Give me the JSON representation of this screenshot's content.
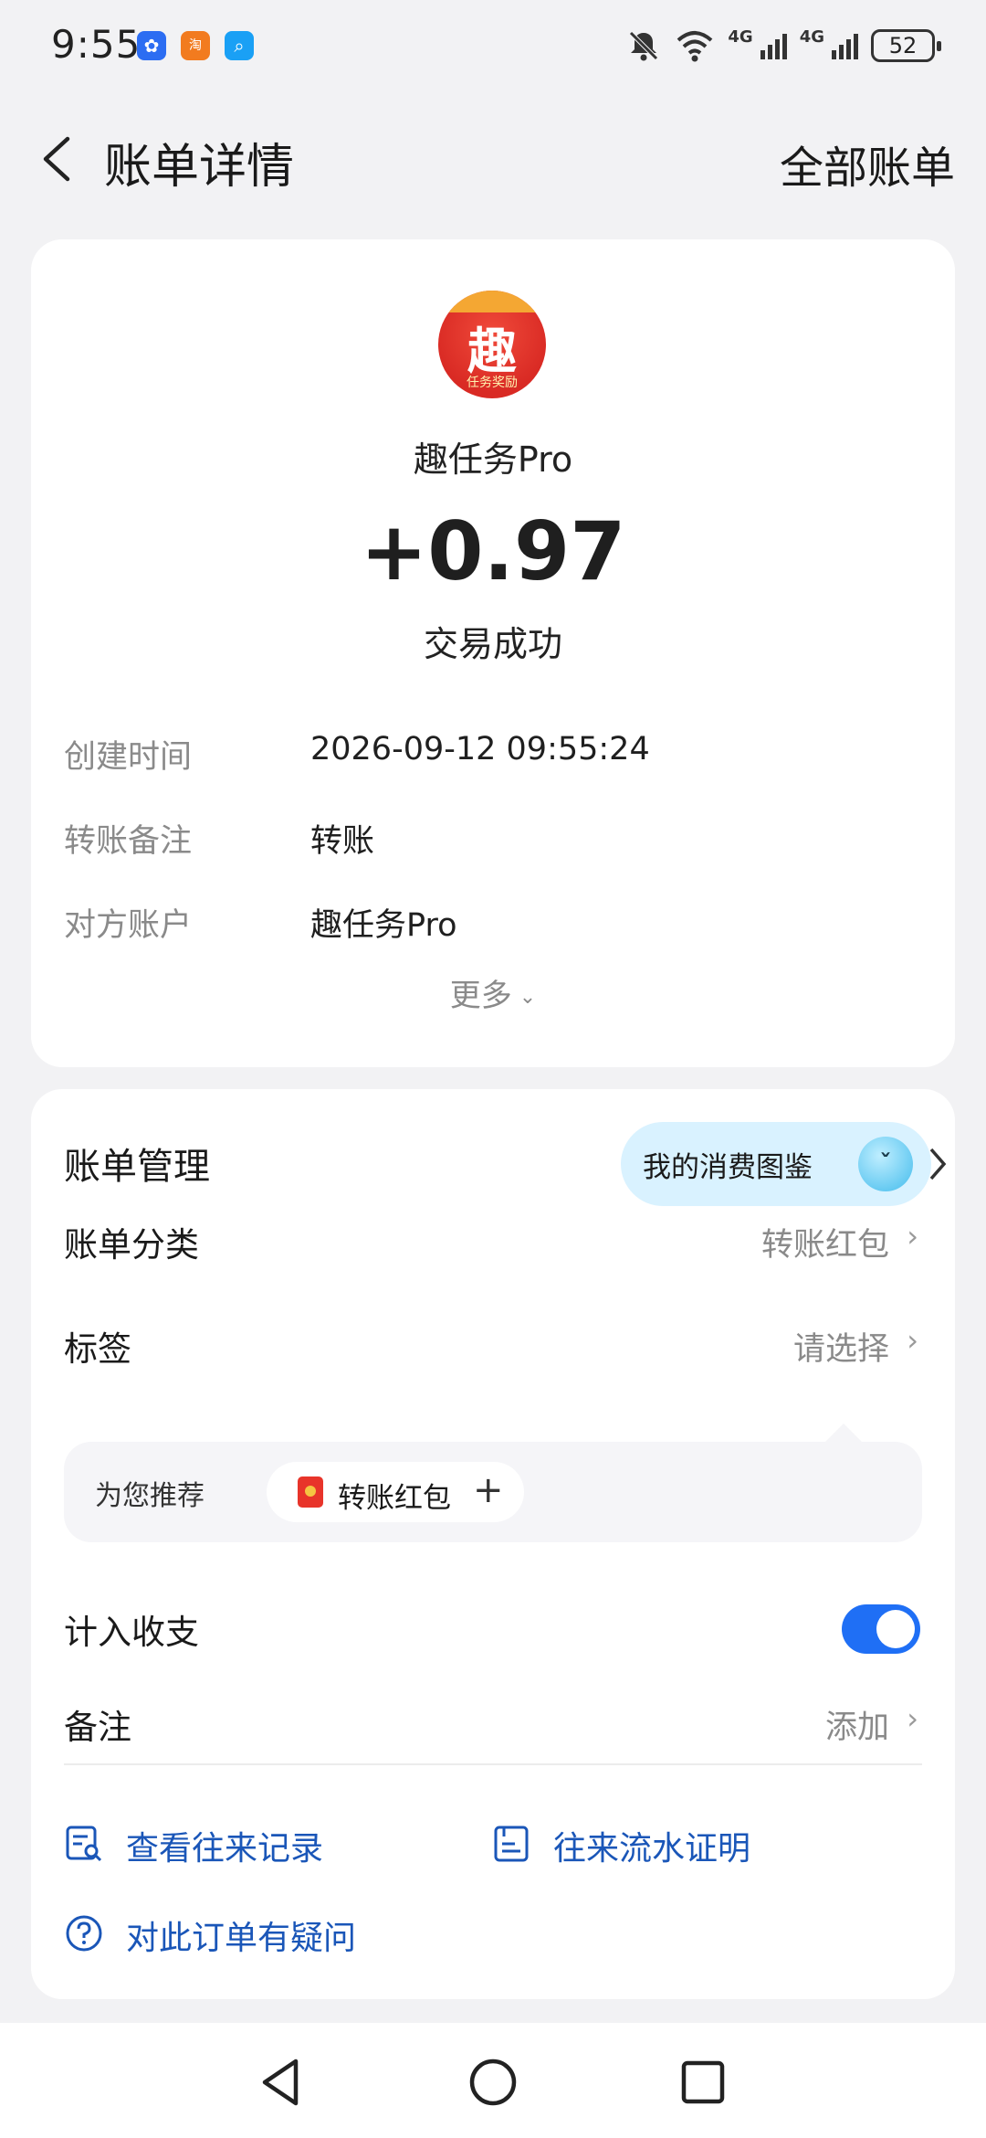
{
  "status_bar": {
    "time": "9:55",
    "app_icons": [
      "baidu-icon",
      "taobao-icon",
      "search-app-icon"
    ],
    "network_1": "4G",
    "network_2": "4G",
    "battery": "52"
  },
  "nav": {
    "title": "账单详情",
    "right_action": "全部账单"
  },
  "transaction": {
    "app_name": "趣任务Pro",
    "logo_char": "趣",
    "logo_sub": "任务奖励",
    "amount": "+0.97",
    "status": "交易成功",
    "details": [
      {
        "key": "创建时间",
        "value": "2026-09-12 09:55:24"
      },
      {
        "key": "转账备注",
        "value": "转账"
      },
      {
        "key": "对方账户",
        "value": "趣任务Pro"
      }
    ],
    "more_label": "更多"
  },
  "management": {
    "title": "账单管理",
    "pill_label": "我的消费图鉴",
    "category": {
      "label": "账单分类",
      "value": "转账红包"
    },
    "tag": {
      "label": "标签",
      "value": "请选择"
    },
    "recommend": {
      "label": "为您推荐",
      "chip": "转账红包"
    },
    "include": {
      "label": "计入收支",
      "enabled": true
    },
    "note": {
      "label": "备注",
      "value": "添加"
    },
    "links": [
      {
        "label": "查看往来记录",
        "icon": "records-icon"
      },
      {
        "label": "往来流水证明",
        "icon": "statement-icon"
      },
      {
        "label": "对此订单有疑问",
        "icon": "question-icon"
      }
    ]
  },
  "colors": {
    "accent": "#1f6ff5",
    "link": "#1a56b8",
    "background": "#f2f2f4"
  }
}
